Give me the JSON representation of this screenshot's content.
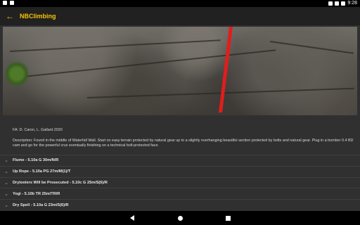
{
  "status_bar": {
    "time": "9:28",
    "left_icons": [
      "alert-icon",
      "storage-icon"
    ],
    "right_icons": [
      "wifi-icon",
      "signal-icon",
      "battery-icon"
    ]
  },
  "app_bar": {
    "title": "NBClimbing",
    "back_icon": "arrow-back-icon"
  },
  "hero_image": {
    "description_icon": "rock-wall-photo",
    "route_line_color": "#e11d1d"
  },
  "info": {
    "fa": "FA: D. Caron, L. Gallant 2020",
    "description": "Description: Found in the middle of Waterfall Wall. Start on easy terrain protected by natural gear up to a slightly overhanging beautiful section protected by bolts and natural gear. Plug in a bomber 0.4 BD cam and go for the powerful crux eventually finishing on a technical bolt-protected face."
  },
  "routes": [
    {
      "label": "Flume - 5.10a G 30m/N/R"
    },
    {
      "label": "Up Rope - 5.10a PG 27m/M(1)/T"
    },
    {
      "label": "Drytoolers Will be Prosecuted - 5.10c G 25m/S(6)/R"
    },
    {
      "label": "Yogi - 5.10b TR 25m/TR/R"
    },
    {
      "label": "Dry Spell - 5.10a G 23m/S(6)/R"
    }
  ],
  "nav_bar": {
    "buttons": [
      "back-icon",
      "home-icon",
      "recents-icon"
    ]
  },
  "colors": {
    "accent": "#f5c400",
    "app_bar_bg": "#212121",
    "page_bg": "#303030"
  }
}
